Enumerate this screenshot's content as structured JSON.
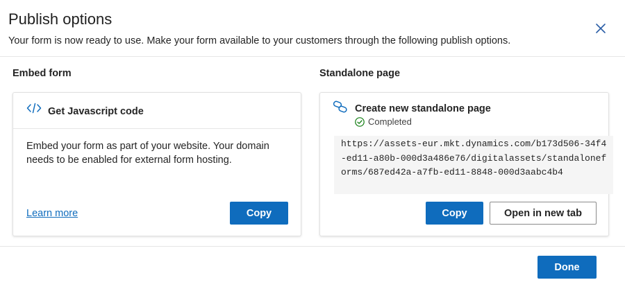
{
  "dialog": {
    "title": "Publish options",
    "subtitle": "Your form is now ready to use. Make your form available to your customers through the following publish options.",
    "close_icon": "close-icon"
  },
  "embed": {
    "section_label": "Embed form",
    "card_title": "Get Javascript code",
    "icon": "code-icon",
    "description": "Embed your form as part of your website. Your domain needs to be enabled for external form hosting.",
    "learn_more": "Learn more",
    "copy_label": "Copy"
  },
  "standalone": {
    "section_label": "Standalone page",
    "card_title": "Create new standalone page",
    "icon": "link-icon",
    "status": "Completed",
    "status_icon": "check-circle-icon",
    "url": "https://assets-eur.mkt.dynamics.com/b173d506-34f4-ed11-a80b-000d3a486e76/digitalassets/standaloneforms/687ed42a-a7fb-ed11-8848-000d3aabc4b4",
    "copy_label": "Copy",
    "open_label": "Open in new tab"
  },
  "footer": {
    "done_label": "Done"
  },
  "colors": {
    "primary": "#0f6cbd",
    "success": "#107c10",
    "text": "#242424"
  }
}
